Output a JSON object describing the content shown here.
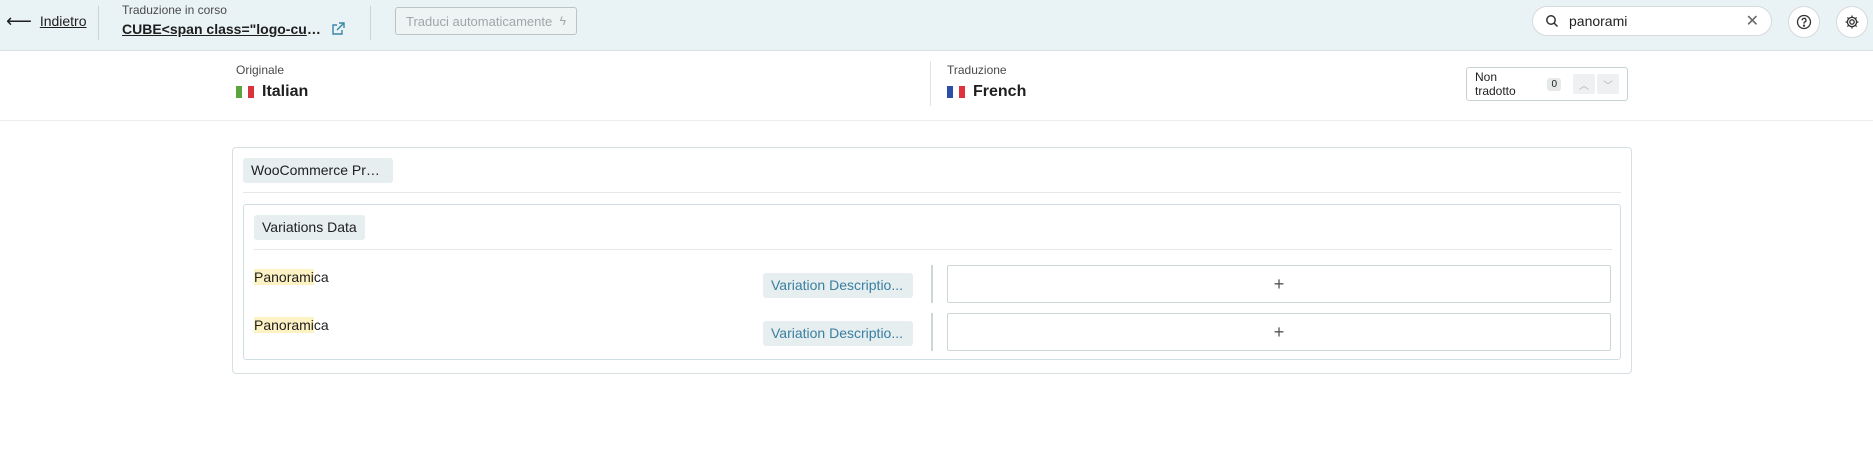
{
  "header": {
    "back_label": "Indietro",
    "progress_label": "Traduzione in corso",
    "job_title": "CUBE<span class=\"logo-cube\"...",
    "auto_translate_label": "Traduci automaticamente",
    "search": {
      "value": "panorami",
      "placeholder": ""
    }
  },
  "languages": {
    "original_label": "Originale",
    "original_lang": "Italian",
    "translation_label": "Traduzione",
    "translation_lang": "French",
    "filter_label": "Non tradotto",
    "filter_count": "0"
  },
  "content": {
    "group_label": "WooCommerce Pro...",
    "section_label": "Variations Data",
    "rows": [
      {
        "source_highlight": "Panorami",
        "source_rest": "ca",
        "field": "Variation Descriptio..."
      },
      {
        "source_highlight": "Panorami",
        "source_rest": "ca",
        "field": "Variation Descriptio..."
      }
    ]
  },
  "colors": {
    "header_bg": "#e9f2f4",
    "accent": "#3a7fa0",
    "highlight": "#fdf2c4"
  }
}
